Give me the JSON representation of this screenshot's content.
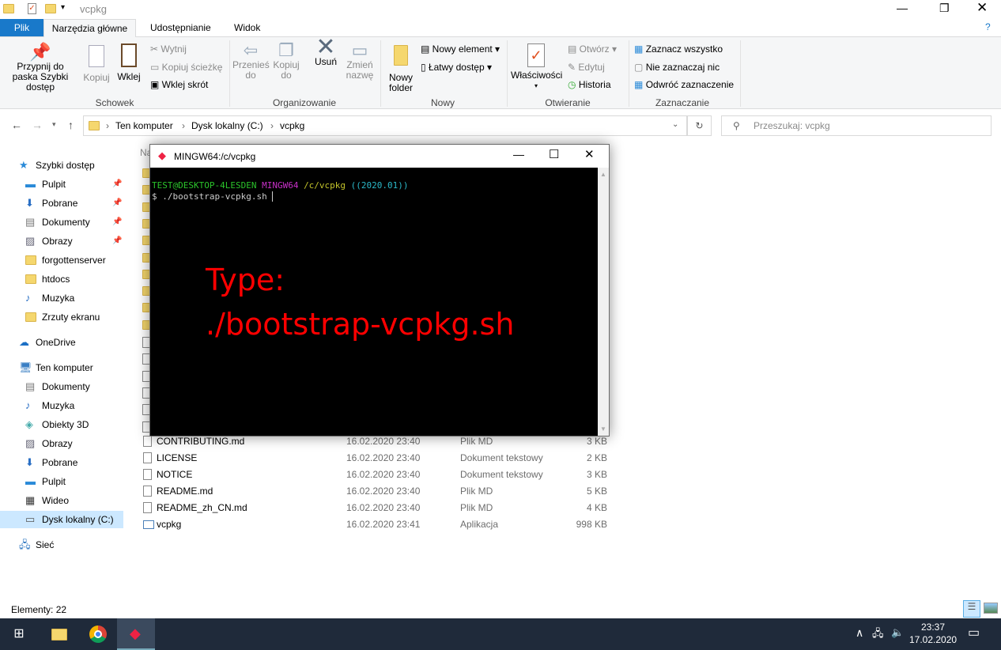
{
  "window": {
    "title": "vcpkg"
  },
  "tabs": [
    {
      "label": "Plik"
    },
    {
      "label": "Narzędzia główne"
    },
    {
      "label": "Udostępnianie"
    },
    {
      "label": "Widok"
    }
  ],
  "ribbon": {
    "schowek": {
      "label": "Schowek",
      "pin": "Przypnij do paska Szybki dostęp",
      "copy": "Kopiuj",
      "paste": "Wklej",
      "cut": "Wytnij",
      "copy_path": "Kopiuj ścieżkę",
      "paste_shortcut": "Wklej skrót"
    },
    "organizowanie": {
      "label": "Organizowanie",
      "move": "Przenieś do",
      "copy_to": "Kopiuj do",
      "delete": "Usuń",
      "rename": "Zmień nazwę"
    },
    "nowy": {
      "label": "Nowy",
      "new_folder": "Nowy folder",
      "new_item": "Nowy element",
      "easy_access": "Łatwy dostęp"
    },
    "otwieranie": {
      "label": "Otwieranie",
      "properties": "Właściwości",
      "open": "Otwórz",
      "edit": "Edytuj",
      "history": "Historia"
    },
    "zaznaczanie": {
      "label": "Zaznaczanie",
      "select_all": "Zaznacz wszystko",
      "select_none": "Nie zaznaczaj nic",
      "invert": "Odwróć zaznaczenie"
    }
  },
  "address": {
    "crumbs": [
      "Ten komputer",
      "Dysk lokalny (C:)",
      "vcpkg"
    ],
    "search_placeholder": "Przeszukaj: vcpkg"
  },
  "nav": [
    {
      "label": "Szybki dostęp",
      "top": true
    },
    {
      "label": "Pulpit",
      "pin": true
    },
    {
      "label": "Pobrane",
      "pin": true
    },
    {
      "label": "Dokumenty",
      "pin": true
    },
    {
      "label": "Obrazy",
      "pin": true
    },
    {
      "label": "forgottenserver"
    },
    {
      "label": "htdocs"
    },
    {
      "label": "Muzyka"
    },
    {
      "label": "Zrzuty ekranu"
    },
    {
      "label": "OneDrive",
      "top": true
    },
    {
      "label": "Ten komputer",
      "top": true
    },
    {
      "label": "Dokumenty"
    },
    {
      "label": "Muzyka"
    },
    {
      "label": "Obiekty 3D"
    },
    {
      "label": "Obrazy"
    },
    {
      "label": "Pobrane"
    },
    {
      "label": "Pulpit"
    },
    {
      "label": "Wideo"
    },
    {
      "label": "Dysk lokalny (C:)",
      "selected": true
    },
    {
      "label": "Sieć",
      "top": true
    }
  ],
  "list_header_partial": "Na",
  "files": [
    {
      "name": "CONTRIBUTING.md",
      "date": "16.02.2020 23:40",
      "type": "Plik MD",
      "size": "3 KB"
    },
    {
      "name": "LICENSE",
      "date": "16.02.2020 23:40",
      "type": "Dokument tekstowy",
      "size": "2 KB"
    },
    {
      "name": "NOTICE",
      "date": "16.02.2020 23:40",
      "type": "Dokument tekstowy",
      "size": "3 KB"
    },
    {
      "name": "README.md",
      "date": "16.02.2020 23:40",
      "type": "Plik MD",
      "size": "5 KB"
    },
    {
      "name": "README_zh_CN.md",
      "date": "16.02.2020 23:40",
      "type": "Plik MD",
      "size": "4 KB"
    },
    {
      "name": "vcpkg",
      "date": "16.02.2020 23:41",
      "type": "Aplikacja",
      "size": "998 KB"
    }
  ],
  "status": {
    "count": "Elementy: 22"
  },
  "terminal": {
    "title": "MINGW64:/c/vcpkg",
    "user": "TEST@DESKTOP-4LESDEN",
    "env": "MINGW64",
    "path": "/c/vcpkg",
    "branch": "((2020.01))",
    "command": "$ ./bootstrap-vcpkg.sh",
    "annotation_line1": "Type:",
    "annotation_line2": "./bootstrap-vcpkg.sh"
  },
  "taskbar": {
    "time": "23:37",
    "date": "17.02.2020"
  },
  "colors": {
    "accent": "#1979ca",
    "taskbar": "#1f2a3a",
    "annotation": "#ff0000"
  }
}
